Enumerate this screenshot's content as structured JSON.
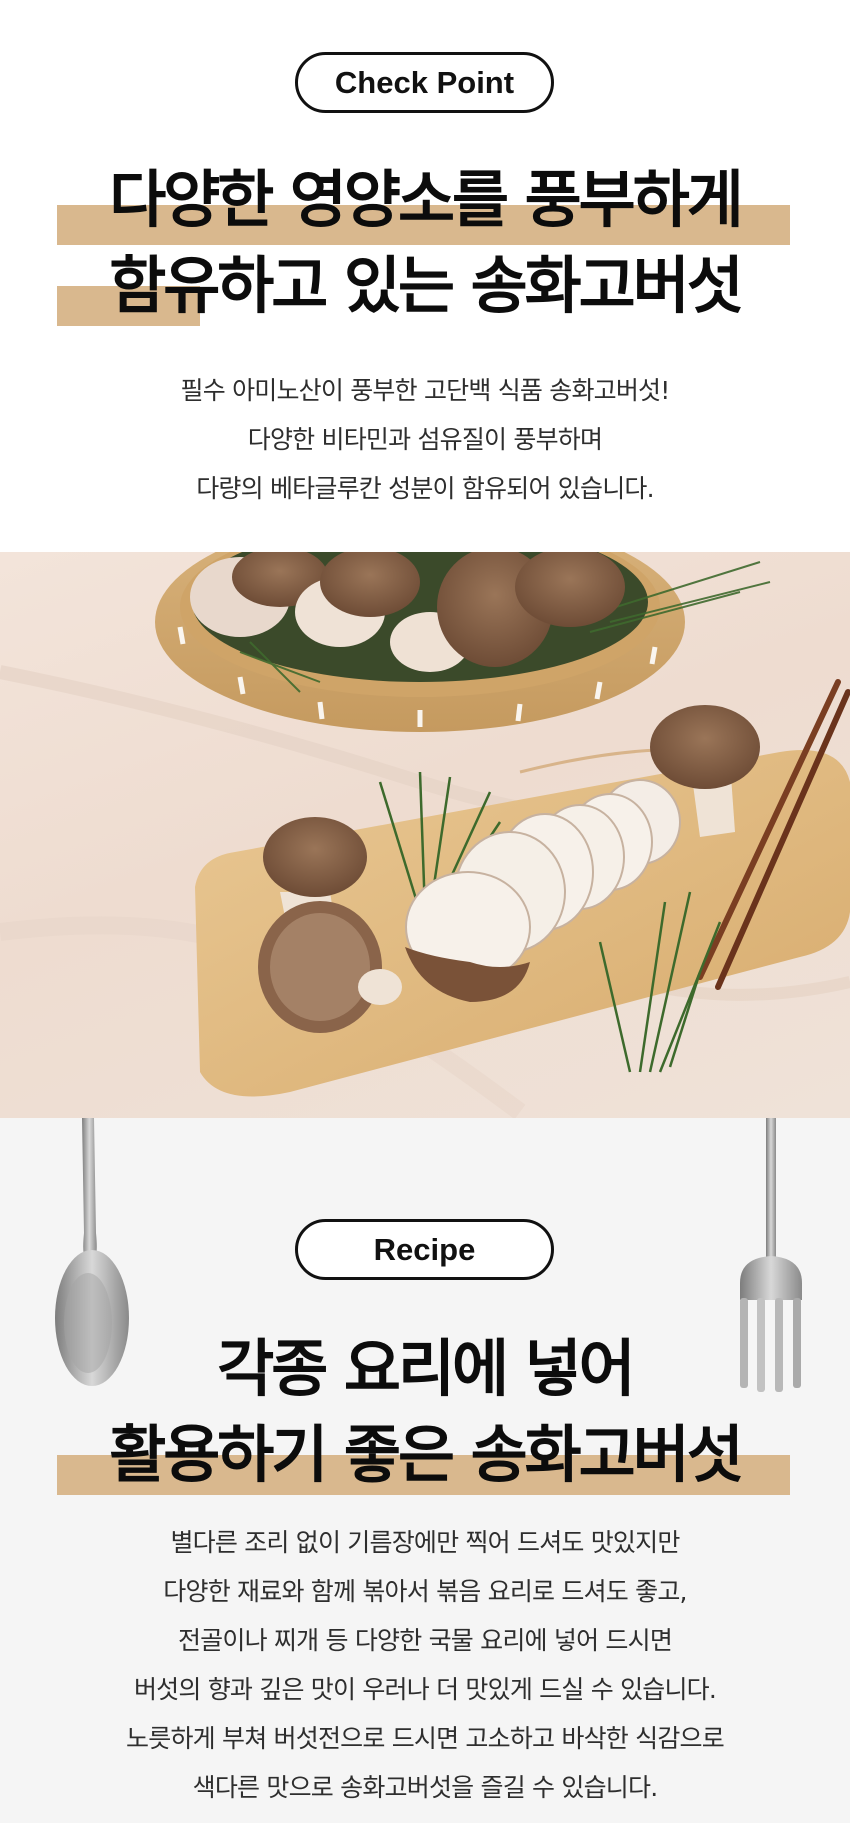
{
  "check_section": {
    "badge": "Check Point",
    "headline": [
      "다양한 영양소를 풍부하게",
      "함유하고 있는 송화고버섯"
    ],
    "body": [
      "필수 아미노산이 풍부한 고단백 식품 송화고버섯!",
      "다양한 비타민과 섬유질이 풍부하며",
      "다량의 베타글루칸 성분이 함유되어 있습니다."
    ]
  },
  "photo": {
    "icon": "mushroom-cutting-board-photo"
  },
  "recipe_section": {
    "badge": "Recipe",
    "headline": [
      "각종 요리에 넣어",
      "활용하기 좋은 송화고버섯"
    ],
    "body": [
      "별다른 조리 없이 기름장에만 찍어 드셔도 맛있지만",
      "다양한 재료와 함께 볶아서 볶음 요리로 드셔도 좋고,",
      "전골이나 찌개 등 다양한 국물 요리에 넣어 드시면",
      "버섯의 향과 깊은 맛이 우러나 더 맛있게 드실 수 있습니다.",
      "노릇하게 부쳐 버섯전으로 드시면 고소하고 바삭한 식감으로",
      "색다른 맛으로 송화고버섯을 즐길 수 있습니다."
    ],
    "left_icon": "spoon-icon",
    "right_icon": "fork-icon"
  },
  "colors": {
    "highlight": "#d9b88e",
    "text": "#111111",
    "recipe_bg": "#f5f5f5"
  }
}
